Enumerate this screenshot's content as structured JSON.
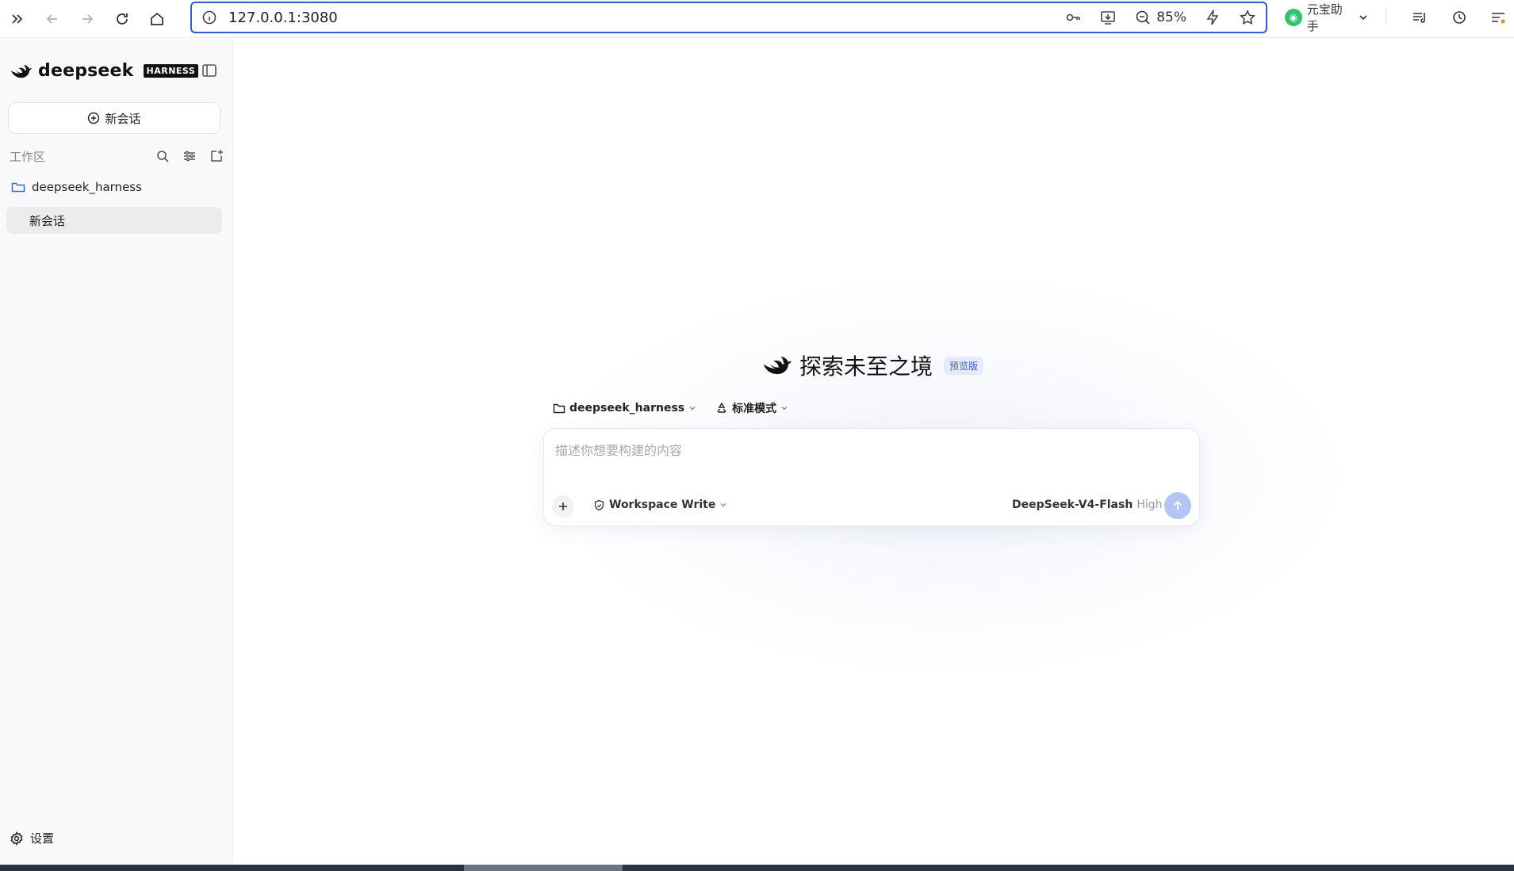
{
  "browser": {
    "url": "127.0.0.1:3080",
    "zoom": "85%",
    "assistant_label": "元宝助手"
  },
  "sidebar": {
    "brand_name": "deepseek",
    "brand_tag": "HARNESS",
    "new_chat_label": "新会话",
    "workspace_label": "工作区",
    "folder_name": "deepseek_harness",
    "sessions": [
      {
        "label": "新会话",
        "active": true
      }
    ],
    "settings_label": "设置"
  },
  "main": {
    "hero_title": "探索未至之境",
    "hero_badge": "预览版",
    "context": {
      "folder": "deepseek_harness",
      "mode": "标准模式"
    },
    "composer": {
      "placeholder": "描述你想要构建的内容",
      "value": "",
      "permission": "Workspace Write",
      "model": "DeepSeek-V4-Flash",
      "level": "High"
    }
  },
  "colors": {
    "accent": "#2e5bd8",
    "send_button": "#b3c5f5",
    "badge_bg": "#e5ebfb",
    "badge_text": "#3b5fd0"
  }
}
